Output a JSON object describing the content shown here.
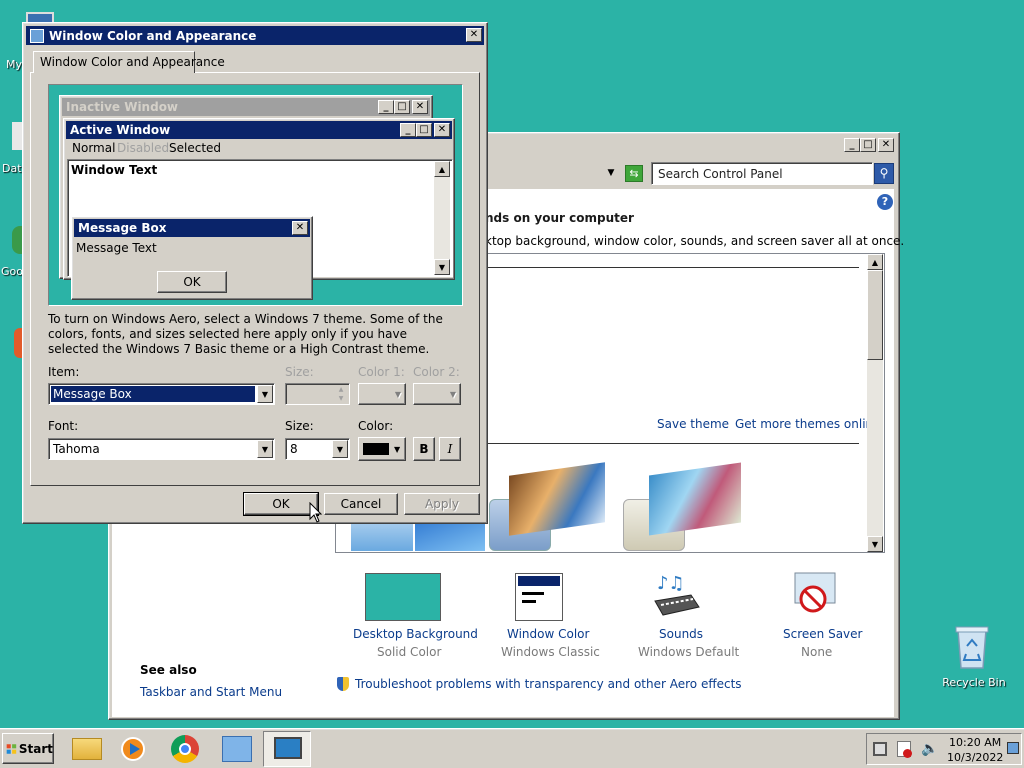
{
  "desktop": {
    "icons": [
      {
        "label": "My"
      },
      {
        "label": "Data"
      },
      {
        "label": "Goo"
      },
      {
        "label": ""
      }
    ],
    "recycle_bin": "Recycle Bin"
  },
  "control_panel": {
    "search_placeholder": "Search Control Panel",
    "heading": "nds on your computer",
    "subheading": "ktop background, window color, sounds, and screen saver all at once.",
    "save_theme": "Save theme",
    "get_more_themes": "Get more themes online",
    "settings": [
      {
        "label": "Desktop Background",
        "value": "Solid Color"
      },
      {
        "label": "Window Color",
        "value": "Windows Classic"
      },
      {
        "label": "Sounds",
        "value": "Windows Default"
      },
      {
        "label": "Screen Saver",
        "value": "None"
      }
    ],
    "see_also": "See also",
    "see_also_link": "Taskbar and Start Menu",
    "troubleshoot": "Troubleshoot problems with transparency and other Aero effects"
  },
  "dialog": {
    "title": "Window Color and Appearance",
    "tab": "Window Color and Appearance",
    "preview": {
      "inactive_title": "Inactive Window",
      "active_title": "Active Window",
      "menu": {
        "normal": "Normal",
        "disabled": "Disabled",
        "selected": "Selected"
      },
      "window_text": "Window Text",
      "message_box_title": "Message Box",
      "message_text": "Message Text",
      "ok": "OK"
    },
    "description": "To turn on Windows Aero, select a Windows 7 theme.  Some of the colors, fonts, and sizes selected here apply only if you have selected the Windows 7 Basic theme or a High Contrast theme.",
    "item_label": "Item:",
    "item_value": "Message Box",
    "size_label": "Size:",
    "color1_label": "Color 1:",
    "color2_label": "Color 2:",
    "font_label": "Font:",
    "font_value": "Tahoma",
    "font_size_label": "Size:",
    "font_size_value": "8",
    "color_label": "Color:",
    "bold": "B",
    "italic": "I",
    "ok": "OK",
    "cancel": "Cancel",
    "apply": "Apply"
  },
  "taskbar": {
    "start": "Start",
    "time": "10:20 AM",
    "date": "10/3/2022"
  },
  "colors": {
    "desktop": "#2bb3a6",
    "titlebar_active": "#0a246a",
    "titlebar_inactive": "#a0a0a0",
    "selection": "#0a246a"
  }
}
